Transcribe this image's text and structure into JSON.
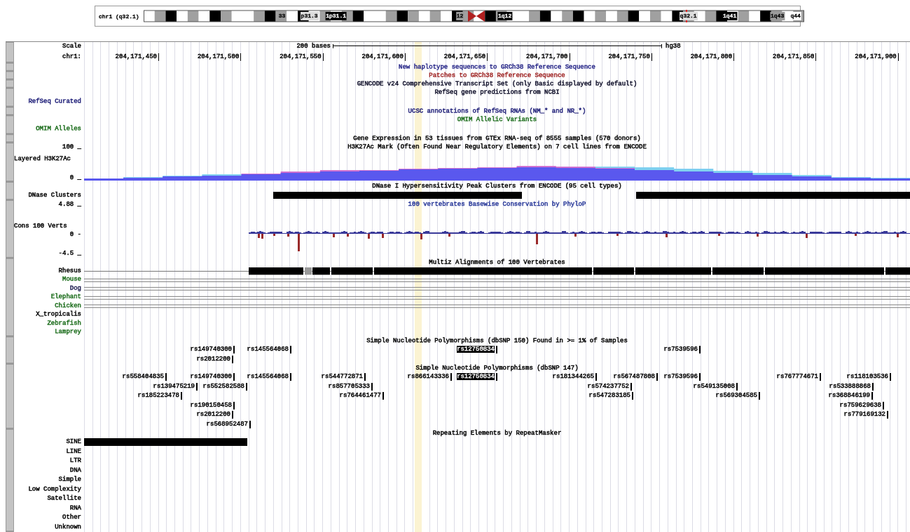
{
  "ideogram": {
    "label": "chr1 (q32.1)",
    "bands": [
      {
        "text": "33",
        "color": "#9a9a9a"
      },
      {
        "text": "p31.3",
        "color": "#dcdcdc"
      },
      {
        "text": "1p31.1",
        "color": "#000000"
      },
      {
        "text": "12",
        "color": "#9a9a9a"
      },
      {
        "text": "1q12",
        "color": "#000000"
      },
      {
        "text": "q32.1",
        "color": "#dcdcdc"
      },
      {
        "text": "1q41",
        "color": "#000000"
      },
      {
        "text": "1q43",
        "color": "#9a9a9a"
      },
      {
        "text": "q44",
        "color": "#ffffff"
      }
    ]
  },
  "rows": [
    {
      "kind": "scale",
      "labels": [
        {
          "text": "Scale",
          "color": "#000000"
        }
      ],
      "span": "200 bases",
      "assembly": "hg38"
    },
    {
      "kind": "ruler",
      "labels": [
        {
          "text": "chr1:",
          "color": "#000000"
        }
      ],
      "ticks": [
        "204,171,450",
        "204,171,500",
        "204,171,550",
        "204,171,600",
        "204,171,650",
        "204,171,700",
        "204,171,750",
        "204,171,800",
        "204,171,850",
        "204,171,900"
      ]
    },
    {
      "kind": "title",
      "title": {
        "text": "New haplotype sequences to GRCh38 Reference Sequence",
        "color": "#2a2a8a"
      }
    },
    {
      "kind": "title",
      "title": {
        "text": "Patches to GRCh38 Reference Sequence",
        "color": "#a02828"
      }
    },
    {
      "kind": "title",
      "title": {
        "text": "GENCODE v24 Comprehensive Transcript Set (only Basic displayed by default)",
        "color": "#10102a"
      }
    },
    {
      "kind": "title",
      "title": {
        "text": "RefSeq gene predictions from NCBI",
        "color": "#10102a"
      }
    },
    {
      "kind": "label",
      "labels": [
        {
          "text": "RefSeq Curated",
          "color": "#1e1e78"
        }
      ]
    },
    {
      "kind": "title",
      "title": {
        "text": "UCSC annotations of RefSeq RNAs (NM_* and NR_*)",
        "color": "#1e1e78"
      }
    },
    {
      "kind": "title",
      "title": {
        "text": "OMIM Allelic Variants",
        "color": "#1e6e1e"
      }
    },
    {
      "kind": "label",
      "labels": [
        {
          "text": "OMIM Alleles",
          "color": "#1e6e1e"
        }
      ]
    },
    {
      "kind": "title",
      "title": {
        "text": "Gene Expression in 53 tissues from GTEx RNA-seq of 8555 samples (570 donors)",
        "color": "#000000"
      }
    },
    {
      "kind": "title",
      "labels": [
        {
          "text": "100 _",
          "color": "#000000"
        }
      ],
      "title": {
        "text": "H3K27Ac Mark (Often Found Near Regulatory Elements) on 7 cell lines from ENCODE",
        "color": "#000000"
      }
    },
    {
      "kind": "signal",
      "labels": [
        {
          "text": "Layered H3K27Ac",
          "color": "#000000"
        },
        {
          "text": "0 _",
          "color": "#000000"
        }
      ]
    },
    {
      "kind": "title",
      "title": {
        "text": "DNase I Hypersensitivity Peak Clusters from ENCODE (95 cell types)",
        "color": "#000000"
      }
    },
    {
      "kind": "clusters",
      "labels": [
        {
          "text": "DNase Clusters",
          "color": "#000000"
        }
      ]
    },
    {
      "kind": "title",
      "labels": [
        {
          "text": "4.88 _",
          "color": "#000000"
        }
      ],
      "title": {
        "text": "100 vertebrates Basewise Conservation by PhyloP",
        "color": "#2a3a9a"
      }
    },
    {
      "kind": "wiggle",
      "labels": [
        {
          "text": "Cons 100 Verts",
          "color": "#000000"
        },
        {
          "text": "0 -",
          "color": "#000000"
        },
        {
          "text": "-4.5 _",
          "color": "#000000"
        }
      ]
    },
    {
      "kind": "title",
      "title": {
        "text": "Multiz Alignments of 100 Vertebrates",
        "color": "#000000"
      }
    },
    {
      "kind": "alignment",
      "labels": [
        {
          "text": "Rhesus",
          "color": "#000000"
        }
      ]
    },
    {
      "kind": "species",
      "aligned": true,
      "labels": [
        {
          "text": "Mouse",
          "color": "#1e6e1e"
        }
      ]
    },
    {
      "kind": "species",
      "aligned": true,
      "labels": [
        {
          "text": "Dog",
          "color": "#1e1e50"
        }
      ]
    },
    {
      "kind": "species",
      "aligned": true,
      "labels": [
        {
          "text": "Elephant",
          "color": "#1e6e1e"
        }
      ]
    },
    {
      "kind": "species",
      "aligned": true,
      "labels": [
        {
          "text": "Chicken",
          "color": "#1e6e1e"
        }
      ]
    },
    {
      "kind": "species",
      "aligned": false,
      "labels": [
        {
          "text": "X_tropicalis",
          "color": "#000000"
        }
      ]
    },
    {
      "kind": "species",
      "aligned": false,
      "labels": [
        {
          "text": "Zebrafish",
          "color": "#1e6e1e"
        }
      ]
    },
    {
      "kind": "species",
      "aligned": false,
      "labels": [
        {
          "text": "Lamprey",
          "color": "#1e6e1e"
        }
      ]
    },
    {
      "kind": "title",
      "title": {
        "text": "Simple Nucleotide Polymorphisms (dbSNP 150) Found in >= 1% of Samples",
        "color": "#000000"
      }
    },
    {
      "kind": "snps",
      "items": [
        {
          "name": "rs149740300",
          "highlighted": false
        },
        {
          "name": "rs145564068",
          "highlighted": false
        },
        {
          "name": "rs12750834",
          "highlighted": true
        },
        {
          "name": "rs7539596",
          "highlighted": false
        }
      ]
    },
    {
      "kind": "snps",
      "items": [
        {
          "name": "rs2012200",
          "highlighted": false
        }
      ]
    },
    {
      "kind": "title",
      "title": {
        "text": "Simple Nucleotide Polymorphisms (dbSNP 147)",
        "color": "#000000"
      }
    },
    {
      "kind": "snps",
      "items": [
        {
          "name": "rs558404835",
          "highlighted": false
        },
        {
          "name": "rs149740300",
          "highlighted": false
        },
        {
          "name": "rs145564068",
          "highlighted": false
        },
        {
          "name": "rs544772871",
          "highlighted": false
        },
        {
          "name": "rs866143336",
          "highlighted": false
        },
        {
          "name": "rs12750834",
          "highlighted": true
        },
        {
          "name": "rs181344265",
          "highlighted": false
        },
        {
          "name": "rs567487808",
          "highlighted": false
        },
        {
          "name": "rs7539596",
          "highlighted": false
        },
        {
          "name": "rs767774671",
          "highlighted": false
        },
        {
          "name": "rs118103536",
          "highlighted": false
        }
      ]
    },
    {
      "kind": "snps",
      "items": [
        {
          "name": "rs139475219",
          "highlighted": false
        },
        {
          "name": "rs552582588",
          "highlighted": false
        },
        {
          "name": "rs857705333",
          "highlighted": false
        },
        {
          "name": "rs574237752",
          "highlighted": false
        },
        {
          "name": "rs549135008",
          "highlighted": false
        },
        {
          "name": "rs533888868",
          "highlighted": false
        }
      ]
    },
    {
      "kind": "snps",
      "items": [
        {
          "name": "rs185223478",
          "highlighted": false
        },
        {
          "name": "rs764461477",
          "highlighted": false
        },
        {
          "name": "rs547283185",
          "highlighted": false
        },
        {
          "name": "rs569304585",
          "highlighted": false
        },
        {
          "name": "rs368846199",
          "highlighted": false
        }
      ]
    },
    {
      "kind": "snps",
      "items": [
        {
          "name": "rs190150458",
          "highlighted": false
        },
        {
          "name": "rs759629638",
          "highlighted": false
        }
      ]
    },
    {
      "kind": "snps",
      "items": [
        {
          "name": "rs2012200",
          "highlighted": false
        },
        {
          "name": "rs779169132",
          "highlighted": false
        }
      ]
    },
    {
      "kind": "snps",
      "items": [
        {
          "name": "rs568952487",
          "highlighted": false
        }
      ]
    },
    {
      "kind": "title",
      "title": {
        "text": "Repeating Elements by RepeatMasker",
        "color": "#000000"
      }
    },
    {
      "kind": "repeat",
      "covered": true,
      "labels": [
        {
          "text": "SINE",
          "color": "#000000"
        }
      ]
    },
    {
      "kind": "repeat",
      "covered": false,
      "labels": [
        {
          "text": "LINE",
          "color": "#000000"
        }
      ]
    },
    {
      "kind": "repeat",
      "covered": false,
      "labels": [
        {
          "text": "LTR",
          "color": "#000000"
        }
      ]
    },
    {
      "kind": "repeat",
      "covered": false,
      "labels": [
        {
          "text": "DNA",
          "color": "#000000"
        }
      ]
    },
    {
      "kind": "repeat",
      "covered": false,
      "labels": [
        {
          "text": "Simple",
          "color": "#000000"
        }
      ]
    },
    {
      "kind": "repeat",
      "covered": false,
      "labels": [
        {
          "text": "Low Complexity",
          "color": "#000000"
        }
      ]
    },
    {
      "kind": "repeat",
      "covered": false,
      "labels": [
        {
          "text": "Satellite",
          "color": "#000000"
        }
      ]
    },
    {
      "kind": "repeat",
      "covered": false,
      "labels": [
        {
          "text": "RNA",
          "color": "#000000"
        }
      ]
    },
    {
      "kind": "repeat",
      "covered": false,
      "labels": [
        {
          "text": "Other",
          "color": "#000000"
        }
      ]
    },
    {
      "kind": "repeat",
      "covered": false,
      "labels": [
        {
          "text": "Unknown",
          "color": "#000000"
        }
      ]
    }
  ]
}
